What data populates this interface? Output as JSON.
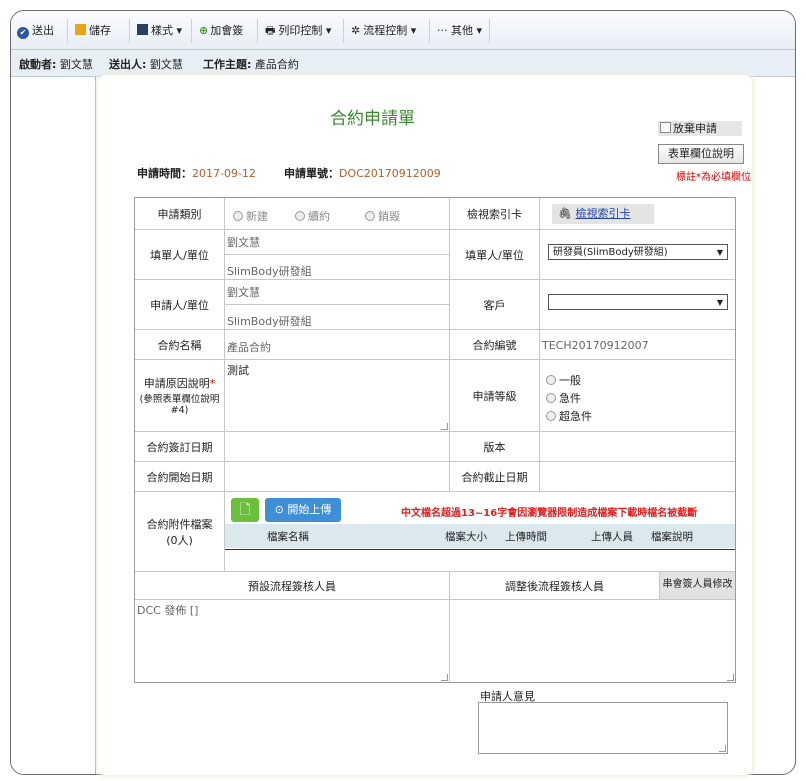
{
  "toolbar": {
    "send": "送出",
    "save": "儲存",
    "style": "樣式 ▾",
    "add_sign": "加會簽",
    "print": "列印控制 ▾",
    "flow": "流程控制 ▾",
    "other": "··· 其他 ▾"
  },
  "infobar": {
    "starter_label": "啟動者:",
    "starter_value": "劉文慧",
    "sender_label": "送出人:",
    "sender_value": "劉文慧",
    "subject_label": "工作主題:",
    "subject_value": "產品合約"
  },
  "form": {
    "title": "合約申請單",
    "give_up": "放棄申請",
    "explain_button": "表單欄位說明",
    "required_note": "標註*為必填欄位",
    "apply_time_label": "申請時間：",
    "apply_time_value": "2017-09-12",
    "apply_no_label": "申請單號：",
    "apply_no_value": "DOC20170912009"
  },
  "rows": {
    "category_label": "申請類別",
    "category_options": [
      "新建",
      "續約",
      "銷毀"
    ],
    "view_card_label": "檢視索引卡",
    "view_card_link": "檢視索引卡",
    "filler_label": "填單人/單位",
    "filler_name": "劉文慧",
    "filler_unit": "SlimBody研發組",
    "filler_label_right": "填單人/單位",
    "filler_select": "研發員(SlimBody研發組)",
    "applicant_label": "申請人/單位",
    "applicant_name": "劉文慧",
    "applicant_unit": "SlimBody研發組",
    "customer_label": "客戶",
    "customer_select": "",
    "contract_name_label": "合約名稱",
    "contract_name_value": "產品合約",
    "contract_no_label": "合約編號",
    "contract_no_value": "TECH20170912007",
    "reason_label": "申請原因說明",
    "reason_sub": "(參照表單欄位說明#4)",
    "reason_value": "測試",
    "level_label": "申請等級",
    "level_options": [
      "一般",
      "急件",
      "超急件"
    ],
    "sign_date_label": "合約簽訂日期",
    "version_label": "版本",
    "start_date_label": "合約開始日期",
    "end_date_label": "合約截止日期",
    "attach_label": "合約附件檔案",
    "attach_count": "(0人)",
    "upload_button": "開始上傳",
    "upload_warning": "中文檔名超過13~16字會因瀏覽器限制造成檔案下載時檔名被截斷",
    "col_filename": "檔案名稱",
    "col_size": "檔案大小",
    "col_time": "上傳時間",
    "col_uploader": "上傳人員",
    "col_desc": "檔案說明",
    "default_flow_label": "預設流程簽核人員",
    "adjusted_flow_label": "調整後流程簽核人員",
    "cosign_button": "串會簽人員修改",
    "default_flow_value": "DCC 發佈 []",
    "applicant_opinion_label": "申請人意見"
  }
}
